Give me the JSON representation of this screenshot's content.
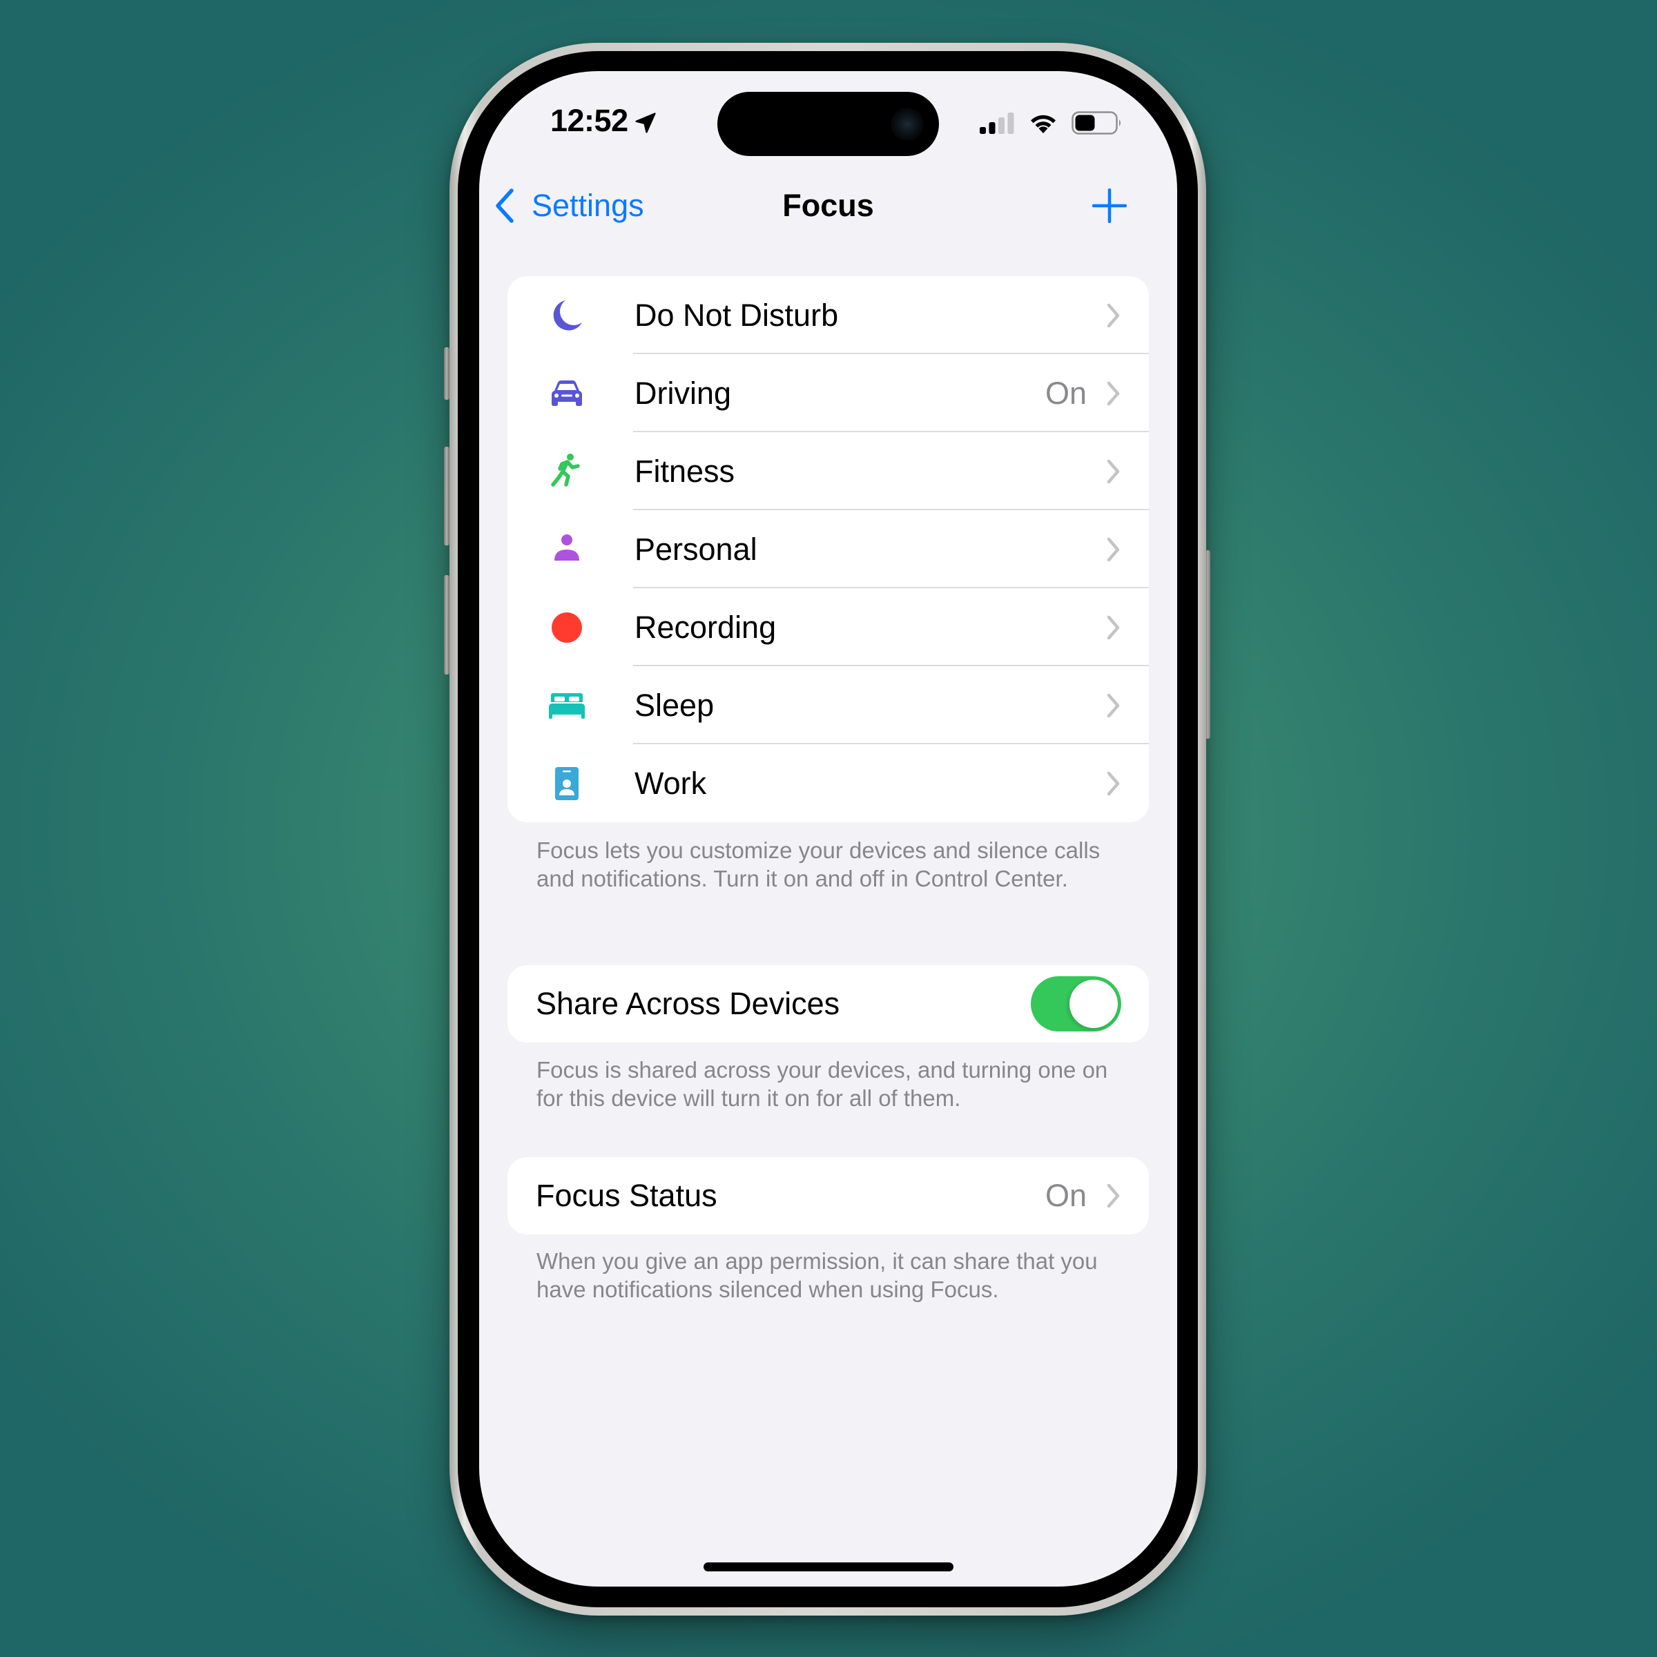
{
  "status_bar": {
    "time": "12:52",
    "location_icon": "location-arrow-icon",
    "signal_bars_filled": 2,
    "signal_bars_total": 4,
    "wifi_icon": "wifi-icon",
    "battery_level_percent": 45
  },
  "nav": {
    "back_label": "Settings",
    "title": "Focus",
    "add_icon": "plus-icon"
  },
  "focus_modes": [
    {
      "label": "Do Not Disturb",
      "icon": "moon-icon",
      "color": "#5856d6",
      "value": ""
    },
    {
      "label": "Driving",
      "icon": "car-icon",
      "color": "#5856d6",
      "value": "On"
    },
    {
      "label": "Fitness",
      "icon": "running-figure-icon",
      "color": "#34c759",
      "value": ""
    },
    {
      "label": "Personal",
      "icon": "person-icon",
      "color": "#af52de",
      "value": ""
    },
    {
      "label": "Recording",
      "icon": "record-dot-icon",
      "color": "#ff3b30",
      "value": ""
    },
    {
      "label": "Sleep",
      "icon": "bed-icon",
      "color": "#14c3b6",
      "value": ""
    },
    {
      "label": "Work",
      "icon": "id-badge-icon",
      "color": "#3aa8d8",
      "value": ""
    }
  ],
  "focus_modes_footer": "Focus lets you customize your devices and silence calls and notifications. Turn it on and off in Control Center.",
  "share_across_devices": {
    "label": "Share Across Devices",
    "enabled": true,
    "footer": "Focus is shared across your devices, and turning one on for this device will turn it on for all of them."
  },
  "focus_status": {
    "label": "Focus Status",
    "value": "On",
    "footer": "When you give an app permission, it can share that you have notifications silenced when using Focus."
  },
  "colors": {
    "accent": "#0a7aff",
    "toggle_on": "#34c759",
    "background": "#f2f2f7",
    "secondary_text": "#8a8a8e"
  }
}
